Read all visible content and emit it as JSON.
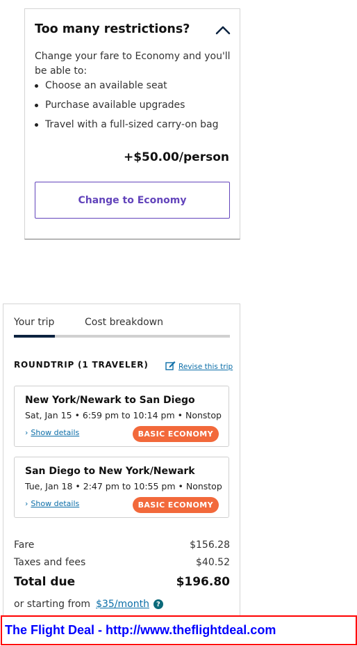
{
  "restrictions": {
    "title": "Too many restrictions?",
    "description": "Change your fare to Economy and you'll be able to:",
    "benefits": [
      "Choose an available seat",
      "Purchase available upgrades",
      "Travel with a full-sized carry-on bag"
    ],
    "price": "+$50.00/person",
    "button_label": "Change to Economy",
    "expanded": true
  },
  "trip": {
    "tabs": [
      {
        "label": "Your trip",
        "active": true
      },
      {
        "label": "Cost breakdown",
        "active": false
      }
    ],
    "trip_type": "ROUNDTRIP (1 TRAVELER)",
    "revise_label": "Revise this trip",
    "flights": [
      {
        "route": "New York/Newark to San Diego",
        "times": "Sat, Jan 15 • 6:59 pm to 10:14 pm • Nonstop",
        "details_label": "Show details",
        "fare_class": "BASIC ECONOMY"
      },
      {
        "route": "San Diego to New York/Newark",
        "times": "Tue, Jan 18 • 2:47 pm to 10:55 pm • Nonstop",
        "details_label": "Show details",
        "fare_class": "BASIC ECONOMY"
      }
    ],
    "costs": {
      "fare_label": "Fare",
      "fare_value": "$156.28",
      "taxes_label": "Taxes and fees",
      "taxes_value": "$40.52",
      "total_label": "Total due",
      "total_value": "$196.80"
    },
    "financing": {
      "prefix": "or starting from",
      "monthly": "$35/month",
      "help_symbol": "?"
    }
  },
  "watermark": {
    "text": "The Flight Deal - http://www.theflightdeal.com"
  },
  "colors": {
    "accent_purple": "#6244bb",
    "link_blue": "#0c6ea8",
    "badge_orange": "#f2693b",
    "tab_active": "#0c2340",
    "watermark_text": "#0000ff",
    "watermark_border": "#ff0000"
  },
  "icons": [
    "chevron-up-icon",
    "edit-icon",
    "chevron-right-icon",
    "help-icon"
  ]
}
